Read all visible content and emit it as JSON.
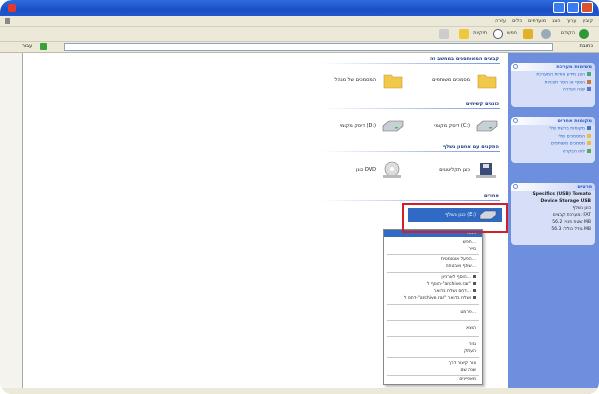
{
  "window": {
    "title": ""
  },
  "colors": {
    "title_bar": "#1a4fc4",
    "side_pane": "#6d8fde",
    "selection": "#316ac5",
    "highlight_box": "#d0202a"
  },
  "menubar": {
    "items": [
      "עזרה",
      "כלים",
      "מועדפים",
      "הצג",
      "ערוך",
      "קובץ"
    ]
  },
  "toolbar": {
    "folders_label": "תיקיות",
    "search_label": "חפש",
    "back_label": "הקודם"
  },
  "address": {
    "label": "כתובת",
    "go_label": "עבור"
  },
  "side_panels": [
    {
      "title": "משימות מערכת",
      "rows": [
        "הצג מידע אודות המערכת",
        "הוסף או הסר תוכניות",
        "שנה הגדרה"
      ]
    },
    {
      "title": "מקומות אחרים",
      "rows": [
        "מקומות ברשת שלי",
        "המסמכים שלי",
        "מסמכים משותפים",
        "לוח הבקרה"
      ]
    },
    {
      "title": "פרטים",
      "rows": [
        "Specifics (USB) Tomato",
        "Device Storage USB",
        "כונן נשלף",
        "מערכת קבצים: FAT",
        "שטח פנוי: 56.2 MB",
        "גודל כולל: 56.3 MB"
      ]
    }
  ],
  "sections": [
    {
      "title": "קבצים המאוחסנים במחשב זה",
      "items": [
        "מסמכים משותפים",
        "המסמכים של מנהל"
      ]
    },
    {
      "title": "כוננים קשיחים",
      "items": [
        "דיסק מקומי (C:)",
        "דיסק מקומי (D:)"
      ]
    },
    {
      "title": "התקנים עם אחסון נשלף",
      "items": [
        "כונן תקליטונים",
        "כונן DVD"
      ]
    },
    {
      "title": "אחרים",
      "items": [
        "כונן נשלף (E:)"
      ]
    }
  ],
  "context_menu": {
    "items": [
      "פתח",
      "חפש...",
      "סייר",
      "הפעל אוטומטית...",
      "שתף ואבטחה...",
      "הוסף לארכיון...",
      "הוסף ל-\"archive.rar\"",
      "דחס ושלח בדואר...",
      "דחס ל-\"archive.rar\" ושלח בדואר",
      "פרמט...",
      "הוצא",
      "גזור",
      "העתק",
      "צור קיצור דרך",
      "שנה שם",
      "מאפיינים"
    ]
  }
}
